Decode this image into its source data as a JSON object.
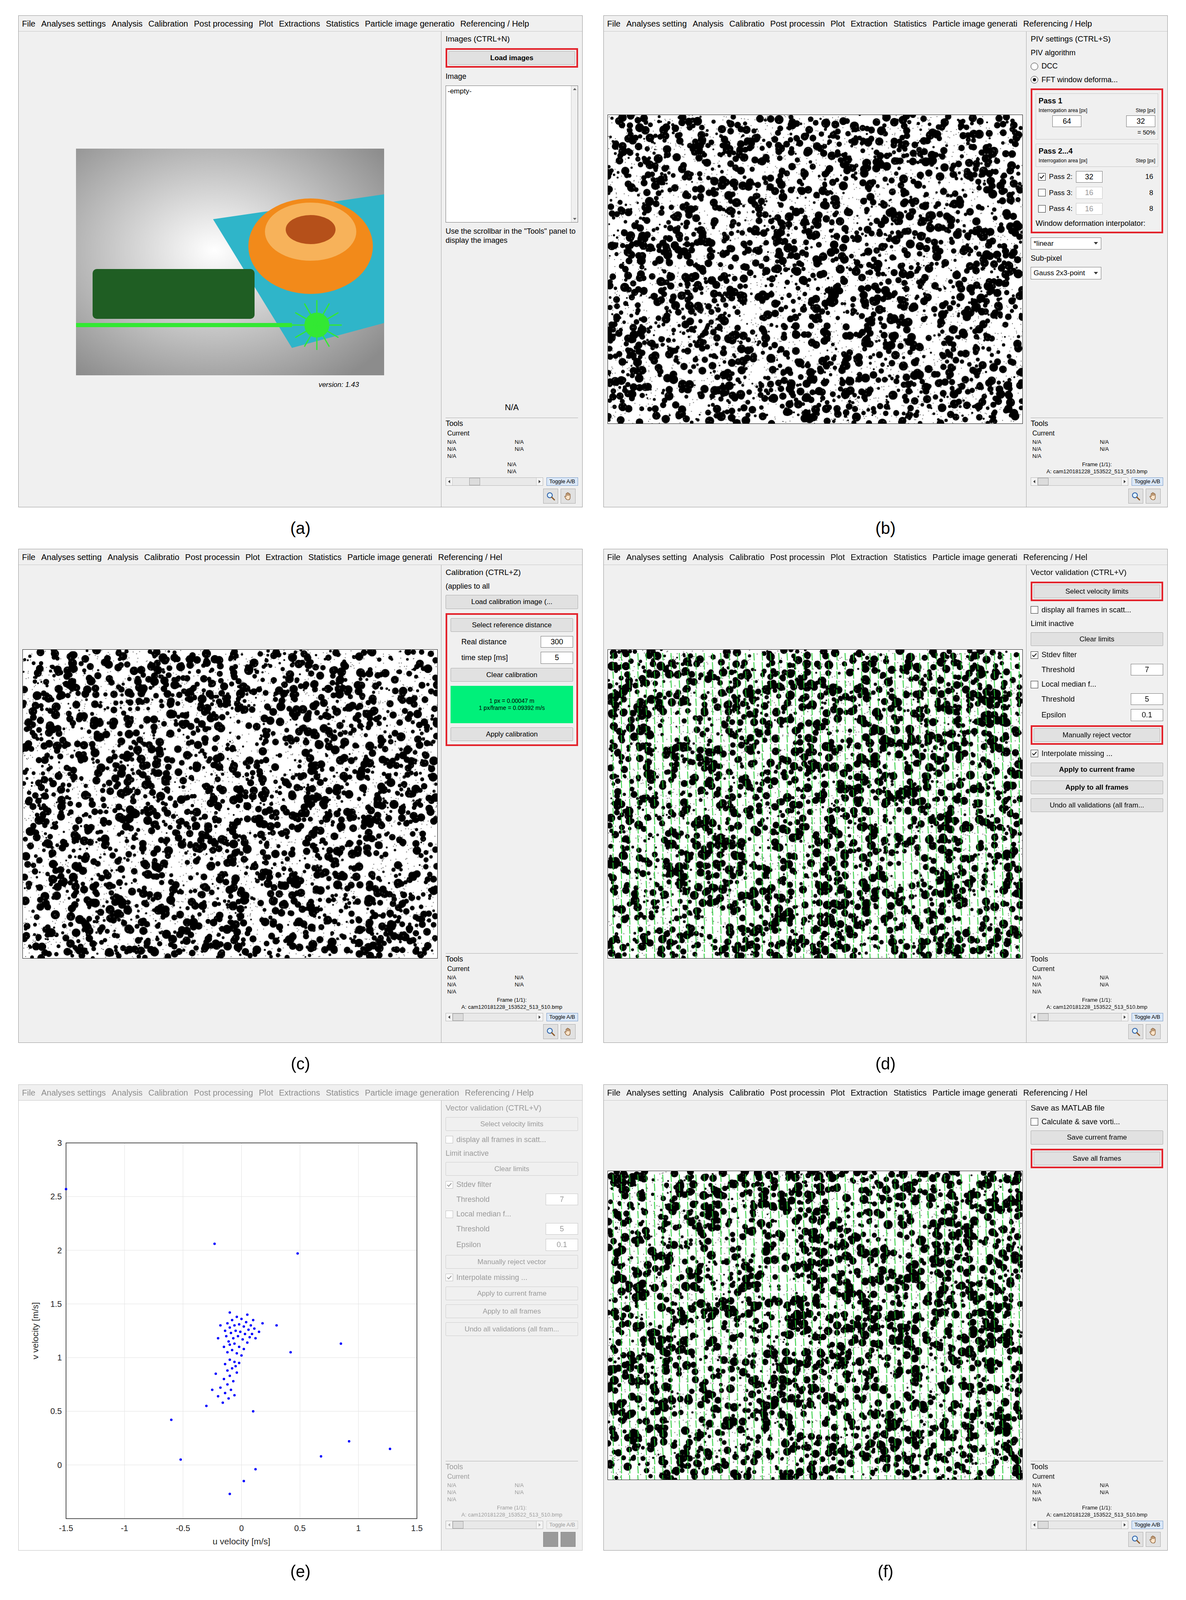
{
  "panels": [
    {
      "label": "(a)",
      "disabled": false,
      "menu": [
        "File",
        "Analyses settings",
        "Analysis",
        "Calibration",
        "Post processing",
        "Plot",
        "Extractions",
        "Statistics",
        "Particle image generatio",
        "Referencing / Help"
      ],
      "main": {
        "kind": "splash",
        "version": "version: 1.43"
      },
      "sidebar": {
        "title": "Images (CTRL+N)",
        "items": [
          {
            "kind": "button",
            "text": "Load images",
            "bold": true,
            "highlighted": true
          },
          {
            "kind": "label",
            "text": "Image"
          },
          {
            "kind": "listbox",
            "entries": [
              "-empty-"
            ]
          },
          {
            "kind": "label",
            "text": "Use the scrollbar in the \"Tools\" panel to display the images"
          }
        ]
      },
      "tools": {
        "note": "N/A",
        "title": "Tools",
        "current": "Current",
        "rows": [
          [
            "N/A",
            "N/A"
          ],
          [
            "N/A",
            "N/A"
          ],
          [
            "N/A"
          ]
        ],
        "lines": [
          "N/A",
          "N/A"
        ],
        "slider_level": 0.25,
        "toggle": "Toggle A/B"
      }
    },
    {
      "label": "(b)",
      "disabled": false,
      "menu": [
        "File",
        "Analyses setting",
        "Analysis",
        "Calibratio",
        "Post processin",
        "Plot",
        "Extraction",
        "Statistics",
        "Particle image generati",
        "Referencing / Help"
      ],
      "main": {
        "kind": "image",
        "vectors": false
      },
      "sidebar": {
        "title": "PIV settings (CTRL+S)",
        "items": [
          {
            "kind": "label",
            "text": "PIV algorithm"
          },
          {
            "kind": "radio",
            "text": "DCC",
            "selected": false
          },
          {
            "kind": "radio",
            "text": "FFT window deforma...",
            "selected": true
          },
          {
            "kind": "group",
            "highlighted": true,
            "items": [
              {
                "kind": "pass1",
                "title": "Pass 1",
                "col1": "Interrogation area [px]",
                "col2": "Step [px]",
                "area": "64",
                "step": "32",
                "note": "= 50%"
              },
              {
                "kind": "pass_header",
                "title": "Pass 2...4",
                "col1": "Interrogation area [px]",
                "col2": "Step [px]"
              },
              {
                "kind": "pass_row",
                "text": "Pass 2:",
                "checked": true,
                "area": "32",
                "step": "16"
              },
              {
                "kind": "pass_row",
                "text": "Pass 3:",
                "checked": false,
                "area": "16",
                "step": "8"
              },
              {
                "kind": "pass_row",
                "text": "Pass 4:",
                "checked": false,
                "area": "16",
                "step": "8"
              },
              {
                "kind": "label",
                "text": "Window deformation interpolator:"
              }
            ]
          },
          {
            "kind": "select",
            "value": "*linear"
          },
          {
            "kind": "label",
            "text": "Sub-pixel"
          },
          {
            "kind": "select",
            "value": "Gauss 2x3-point"
          }
        ]
      },
      "tools": {
        "title": "Tools",
        "current": "Current",
        "rows": [
          [
            "N/A",
            "N/A"
          ],
          [
            "N/A",
            "N/A"
          ],
          [
            "N/A"
          ]
        ],
        "lines": [
          "Frame (1/1):",
          "A: cam120181228_153522_513_510.bmp"
        ],
        "slider_level": 0,
        "toggle": "Toggle A/B"
      }
    },
    {
      "label": "(c)",
      "disabled": false,
      "menu": [
        "File",
        "Analyses setting",
        "Analysis",
        "Calibratio",
        "Post processin",
        "Plot",
        "Extraction",
        "Statistics",
        "Particle image generati",
        "Referencing / Hel"
      ],
      "main": {
        "kind": "image",
        "vectors": false
      },
      "sidebar": {
        "title": "Calibration (CTRL+Z)",
        "items": [
          {
            "kind": "label",
            "text": "(applies to all"
          },
          {
            "kind": "button",
            "text": "Load calibration image (...",
            "bold": false,
            "highlighted": false
          },
          {
            "kind": "group",
            "highlighted": true,
            "items": [
              {
                "kind": "button",
                "text": "Select reference distance",
                "bold": false,
                "highlighted": false
              },
              {
                "kind": "field",
                "text": "Real distance",
                "value": "300"
              },
              {
                "kind": "field",
                "text": "time step [ms]",
                "value": "5"
              },
              {
                "kind": "button",
                "text": "Clear calibration",
                "bold": false,
                "highlighted": false
              },
              {
                "kind": "status",
                "lines": [
                  "1 px = 0.00047 m",
                  "1 px/frame = 0.09392 m/s"
                ]
              },
              {
                "kind": "button",
                "text": "Apply calibration",
                "bold": false,
                "highlighted": false
              }
            ]
          }
        ]
      },
      "tools": {
        "title": "Tools",
        "current": "Current",
        "rows": [
          [
            "N/A",
            "N/A"
          ],
          [
            "N/A",
            "N/A"
          ],
          [
            "N/A"
          ]
        ],
        "lines": [
          "Frame (1/1):",
          "A: cam120181228_153522_513_510.bmp"
        ],
        "slider_level": 0,
        "toggle": "Toggle A/B"
      }
    },
    {
      "label": "(d)",
      "disabled": false,
      "menu": [
        "File",
        "Analyses setting",
        "Analysis",
        "Calibratio",
        "Post processin",
        "Plot",
        "Extraction",
        "Statistics",
        "Particle image generati",
        "Referencing / Hel"
      ],
      "main": {
        "kind": "image",
        "vectors": true
      },
      "sidebar": {
        "title": "Vector validation (CTRL+V)",
        "items": [
          {
            "kind": "button",
            "text": "Select velocity limits",
            "bold": false,
            "highlighted": true
          },
          {
            "kind": "checkbox",
            "text": "display all frames in scatt...",
            "checked": false
          },
          {
            "kind": "label",
            "text": "Limit inactive"
          },
          {
            "kind": "button",
            "text": "Clear limits",
            "bold": false,
            "highlighted": false
          },
          {
            "kind": "checkbox",
            "text": "Stdev filter",
            "checked": true
          },
          {
            "kind": "field",
            "text": "Threshold",
            "value": "7"
          },
          {
            "kind": "checkbox",
            "text": "Local median f...",
            "checked": false
          },
          {
            "kind": "field",
            "text": "Threshold",
            "value": "5"
          },
          {
            "kind": "field",
            "text": "Epsilon",
            "value": "0.1"
          },
          {
            "kind": "button",
            "text": "Manually reject vector",
            "bold": false,
            "highlighted": true
          },
          {
            "kind": "checkbox",
            "text": "Interpolate missing ...",
            "checked": true
          },
          {
            "kind": "button",
            "text": "Apply to current frame",
            "bold": true,
            "highlighted": false
          },
          {
            "kind": "button",
            "text": "Apply to all frames",
            "bold": true,
            "highlighted": false
          },
          {
            "kind": "button",
            "text": "Undo all validations (all fram...",
            "bold": false,
            "highlighted": false
          }
        ]
      },
      "tools": {
        "title": "Tools",
        "current": "Current",
        "rows": [
          [
            "N/A",
            "N/A"
          ],
          [
            "N/A",
            "N/A"
          ],
          [
            "N/A"
          ]
        ],
        "lines": [
          "Frame (1/1):",
          "A: cam120181228_153522_513_510.bmp"
        ],
        "slider_level": 0,
        "toggle": "Toggle A/B"
      }
    },
    {
      "label": "(e)",
      "disabled": true,
      "menu": [
        "File",
        "Analyses settings",
        "Analysis",
        "Calibration",
        "Post processing",
        "Plot",
        "Extractions",
        "Statistics",
        "Particle image generation",
        "Referencing / Help"
      ],
      "main": {
        "kind": "chart",
        "y_label": "v velocity [m/s]",
        "x_label": "u velocity [m/s]",
        "y_ticks": [
          "3",
          "2.5",
          "2",
          "1.5",
          "1",
          "0.5",
          "0"
        ],
        "x_ticks": [
          "-1.5",
          "-1",
          "-0.5",
          "0",
          "0.5",
          "1",
          "1.5"
        ],
        "points": [
          [
            -0.12,
            1.32
          ],
          [
            -0.08,
            1.35
          ],
          [
            -0.04,
            1.38
          ],
          [
            0,
            1.36
          ],
          [
            0.04,
            1.33
          ],
          [
            0.08,
            1.3
          ],
          [
            0.11,
            1.27
          ],
          [
            -0.14,
            1.25
          ],
          [
            -0.1,
            1.28
          ],
          [
            -0.06,
            1.3
          ],
          [
            -0.02,
            1.31
          ],
          [
            0.02,
            1.29
          ],
          [
            0.06,
            1.26
          ],
          [
            0.09,
            1.22
          ],
          [
            -0.13,
            1.2
          ],
          [
            -0.09,
            1.23
          ],
          [
            -0.05,
            1.25
          ],
          [
            -0.01,
            1.24
          ],
          [
            0.03,
            1.22
          ],
          [
            0.07,
            1.19
          ],
          [
            -0.11,
            1.15
          ],
          [
            -0.07,
            1.18
          ],
          [
            -0.03,
            1.2
          ],
          [
            0.01,
            1.17
          ],
          [
            0.05,
            1.14
          ],
          [
            -0.15,
            1.1
          ],
          [
            -0.1,
            1.12
          ],
          [
            -0.06,
            1.13
          ],
          [
            -0.02,
            1.1
          ],
          [
            0.02,
            1.08
          ],
          [
            -0.12,
            1.05
          ],
          [
            -0.08,
            1.07
          ],
          [
            -0.04,
            1.04
          ],
          [
            0,
            1.02
          ],
          [
            0.12,
            1.18
          ],
          [
            0.15,
            1.24
          ],
          [
            0.18,
            1.32
          ],
          [
            -0.18,
            1.3
          ],
          [
            -0.2,
            1.18
          ],
          [
            0.05,
            1.4
          ],
          [
            -0.1,
            1.42
          ],
          [
            0.1,
            1.35
          ],
          [
            -0.1,
            0.98
          ],
          [
            -0.06,
            0.96
          ],
          [
            -0.14,
            0.94
          ],
          [
            -0.08,
            0.9
          ],
          [
            -0.12,
            0.88
          ],
          [
            -0.04,
            0.86
          ],
          [
            -0.1,
            0.83
          ],
          [
            -0.15,
            0.8
          ],
          [
            -0.07,
            0.78
          ],
          [
            -0.12,
            0.75
          ],
          [
            -0.18,
            0.72
          ],
          [
            -0.09,
            0.7
          ],
          [
            -0.14,
            0.67
          ],
          [
            -0.2,
            0.64
          ],
          [
            -0.11,
            0.62
          ],
          [
            -0.16,
            0.58
          ],
          [
            -0.05,
            0.92
          ],
          [
            -0.02,
            0.95
          ],
          [
            -0.22,
            0.85
          ],
          [
            -0.25,
            0.7
          ],
          [
            -0.06,
            0.65
          ],
          [
            -0.3,
            0.55
          ],
          [
            -1.5,
            2.57
          ],
          [
            -0.23,
            2.06
          ],
          [
            0.48,
            1.97
          ],
          [
            0.3,
            1.3
          ],
          [
            0.42,
            1.05
          ],
          [
            0.85,
            1.13
          ],
          [
            0.92,
            0.22
          ],
          [
            1.27,
            0.15
          ],
          [
            0.68,
            0.08
          ],
          [
            -0.6,
            0.42
          ],
          [
            -0.52,
            0.05
          ],
          [
            0.12,
            -0.04
          ],
          [
            -0.1,
            -0.27
          ],
          [
            0.02,
            -0.15
          ],
          [
            0.1,
            0.5
          ]
        ]
      },
      "sidebar": {
        "title": "Vector validation (CTRL+V)",
        "items": [
          {
            "kind": "button",
            "text": "Select velocity limits",
            "bold": false,
            "highlighted": false
          },
          {
            "kind": "checkbox",
            "text": "display all frames in scatt...",
            "checked": false
          },
          {
            "kind": "label",
            "text": "Limit inactive"
          },
          {
            "kind": "button",
            "text": "Clear limits",
            "bold": false,
            "highlighted": false
          },
          {
            "kind": "checkbox",
            "text": "Stdev filter",
            "checked": true
          },
          {
            "kind": "field",
            "text": "Threshold",
            "value": "7"
          },
          {
            "kind": "checkbox",
            "text": "Local median f...",
            "checked": false
          },
          {
            "kind": "field",
            "text": "Threshold",
            "value": "5"
          },
          {
            "kind": "field",
            "text": "Epsilon",
            "value": "0.1"
          },
          {
            "kind": "button",
            "text": "Manually reject vector",
            "bold": false,
            "highlighted": false
          },
          {
            "kind": "checkbox",
            "text": "Interpolate missing ...",
            "checked": true
          },
          {
            "kind": "button",
            "text": "Apply to current frame",
            "bold": false,
            "highlighted": false
          },
          {
            "kind": "button",
            "text": "Apply to all frames",
            "bold": false,
            "highlighted": false
          },
          {
            "kind": "button",
            "text": "Undo all validations (all fram...",
            "bold": false,
            "highlighted": false
          }
        ]
      },
      "tools": {
        "title": "Tools",
        "current": "Current",
        "rows": [
          [
            "N/A",
            "N/A"
          ],
          [
            "N/A",
            "N/A"
          ],
          [
            "N/A"
          ]
        ],
        "lines": [
          "Frame (1/1):",
          "A: cam120181228_153522_513_510.bmp"
        ],
        "slider_level": 0,
        "toggle": "Toggle A/B"
      }
    },
    {
      "label": "(f)",
      "disabled": false,
      "menu": [
        "File",
        "Analyses setting",
        "Analysis",
        "Calibratio",
        "Post processin",
        "Plot",
        "Extraction",
        "Statistics",
        "Particle image generati",
        "Referencing / Hel"
      ],
      "main": {
        "kind": "image",
        "vectors": true
      },
      "sidebar": {
        "title": "Save as MATLAB file",
        "items": [
          {
            "kind": "checkbox",
            "text": "Calculate & save vorti...",
            "checked": false
          },
          {
            "kind": "button",
            "text": "Save current frame",
            "bold": false,
            "highlighted": false
          },
          {
            "kind": "button",
            "text": "Save all frames",
            "bold": false,
            "highlighted": true
          }
        ]
      },
      "tools": {
        "title": "Tools",
        "current": "Current",
        "rows": [
          [
            "N/A",
            "N/A"
          ],
          [
            "N/A",
            "N/A"
          ],
          [
            "N/A"
          ]
        ],
        "lines": [
          "Frame (1/1):",
          "A: cam120181228_153522_513_510.bmp"
        ],
        "slider_level": 0,
        "toggle": "Toggle A/B"
      }
    }
  ]
}
